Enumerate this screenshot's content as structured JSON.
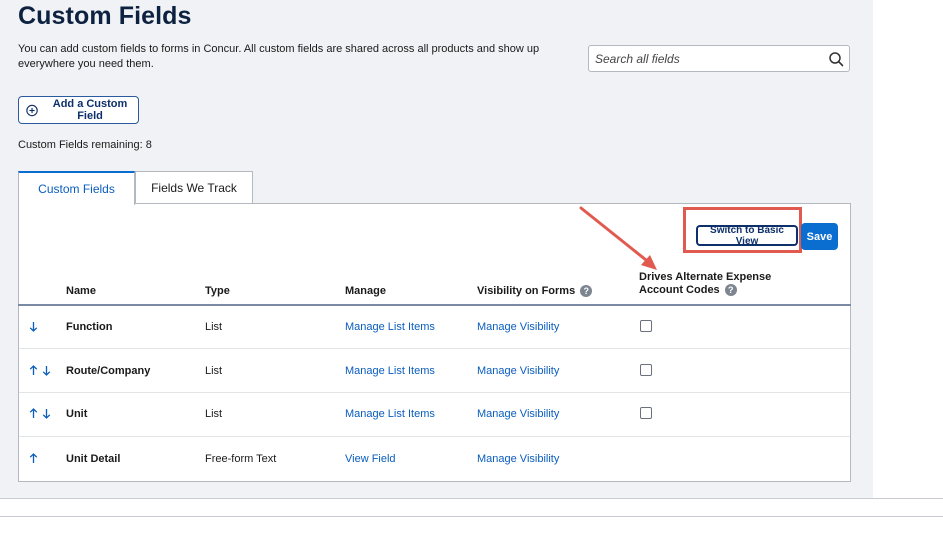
{
  "page": {
    "title": "Custom Fields",
    "description": "You can add custom fields to forms in Concur. All custom fields are shared across all products and show up everywhere you need them.",
    "search_placeholder": "Search all fields",
    "add_button_label": "Add a Custom Field",
    "remaining_label": "Custom Fields remaining: 8"
  },
  "tabs": [
    {
      "label": "Custom Fields",
      "active": true
    },
    {
      "label": "Fields We Track",
      "active": false
    }
  ],
  "toolbar": {
    "switch_view_label": "Switch to Basic View",
    "save_label": "Save"
  },
  "table": {
    "headers": {
      "name": "Name",
      "type": "Type",
      "manage": "Manage",
      "visibility": "Visibility on Forms",
      "drives_line1": "Drives Alternate Expense",
      "drives_line2": "Account Codes"
    },
    "rows": [
      {
        "name": "Function",
        "type": "List",
        "manage": "Manage List Items",
        "visibility": "Manage Visibility",
        "up": false,
        "down": true,
        "checkbox": true
      },
      {
        "name": "Route/Company",
        "type": "List",
        "manage": "Manage List Items",
        "visibility": "Manage Visibility",
        "up": true,
        "down": true,
        "checkbox": true
      },
      {
        "name": "Unit",
        "type": "List",
        "manage": "Manage List Items",
        "visibility": "Manage Visibility",
        "up": true,
        "down": true,
        "checkbox": true
      },
      {
        "name": "Unit Detail",
        "type": "Free-form Text",
        "manage": "View Field",
        "visibility": "Manage Visibility",
        "up": true,
        "down": false,
        "checkbox": false
      }
    ]
  },
  "icons": {
    "search": "search-icon",
    "add": "plus-circle-icon",
    "help": "question-circle-icon",
    "up": "arrow-up-icon",
    "down": "arrow-down-icon",
    "annotation": "annotation-arrow"
  },
  "colors": {
    "title": "#0d2240",
    "link": "#0a5dbd",
    "primary": "#0a6ed1",
    "highlight": "#e05a4f"
  }
}
